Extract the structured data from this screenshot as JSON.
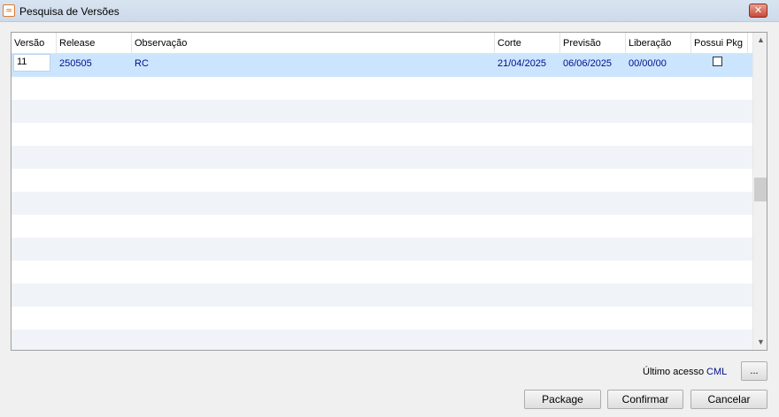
{
  "window": {
    "title": "Pesquisa de Versões",
    "close_label": "✕"
  },
  "grid": {
    "columns": [
      "Versão",
      "Release",
      "Observação",
      "Corte",
      "Previsão",
      "Liberação",
      "Possui Pkg"
    ],
    "rows": [
      {
        "versao": "11",
        "release": "250505",
        "observacao": "RC",
        "corte": "21/04/2025",
        "previsao": "06/06/2025",
        "liberacao": "00/00/00",
        "possui_pkg": false
      }
    ],
    "scroll_up": "▲",
    "scroll_down": "▼"
  },
  "footer": {
    "ultimo_acesso_label": "Último acesso",
    "ultimo_acesso_value": "CML",
    "ellipsis_label": "...",
    "buttons": {
      "package": "Package",
      "confirmar": "Confirmar",
      "cancelar": "Cancelar"
    }
  },
  "colors": {
    "selected_row": "#cce5ff",
    "alt_row": "#f0f3f7",
    "value_text": "#000e8a"
  }
}
